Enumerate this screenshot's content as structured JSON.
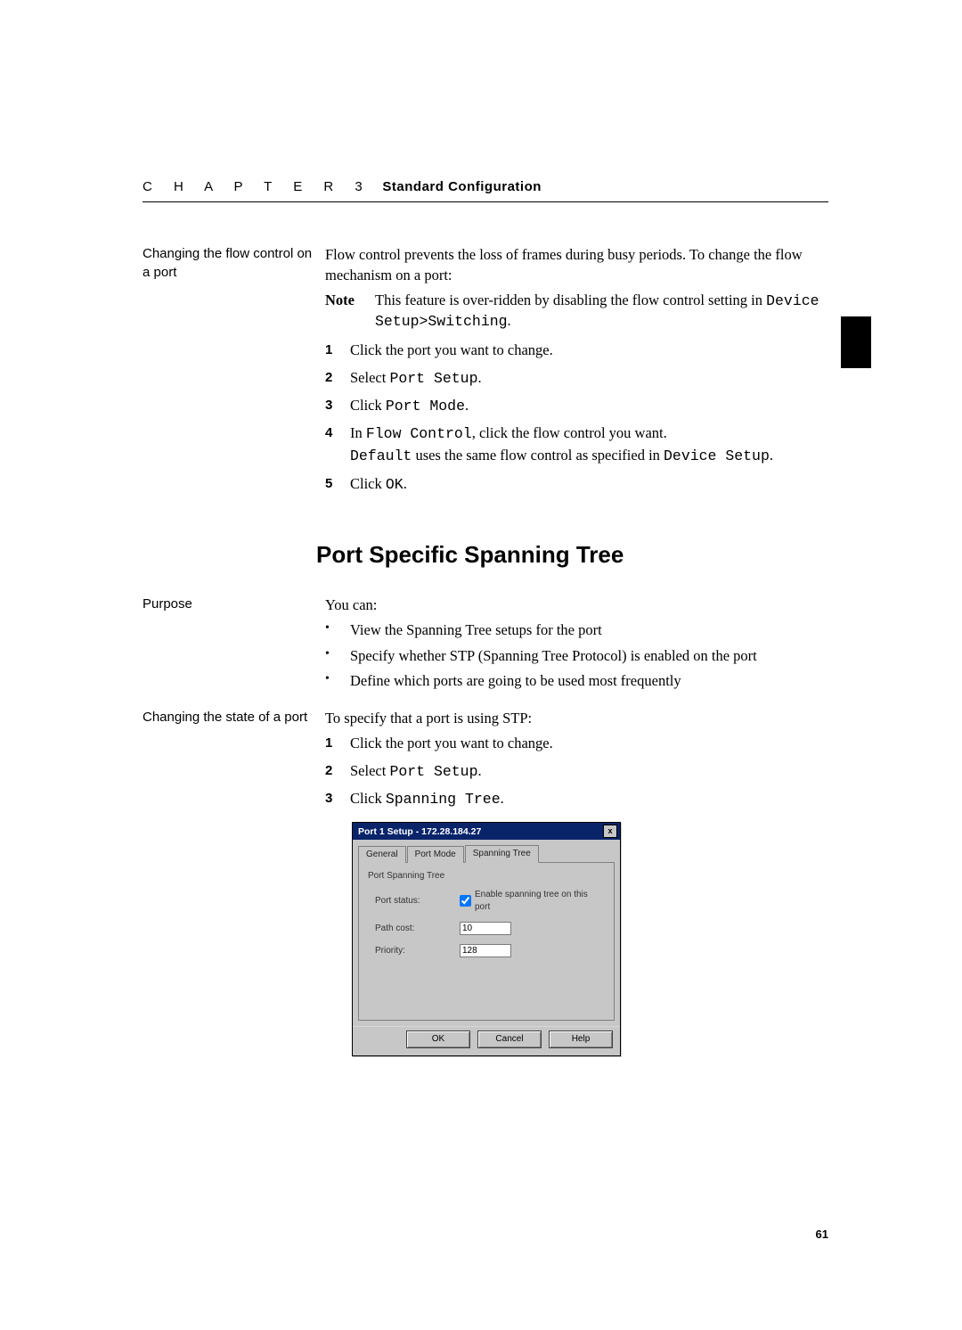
{
  "header": {
    "chapter_word": "C H A P T E R 3",
    "chapter_title": "Standard Configuration"
  },
  "tab_marker": "",
  "section1": {
    "side_label": "Changing the flow control on a port",
    "intro": "Flow control prevents the loss of frames during busy periods. To change the flow mechanism on a port:",
    "note_label": "Note",
    "note_text_a": "This feature is over-ridden by disabling the flow control setting in ",
    "note_code": "Device Setup>Switching",
    "note_period": ".",
    "steps": [
      {
        "n": "1",
        "a": "Click the port you want to change."
      },
      {
        "n": "2",
        "a": "Select ",
        "code": "Port Setup",
        "p": "."
      },
      {
        "n": "3",
        "a": "Click ",
        "code": "Port Mode",
        "p": "."
      },
      {
        "n": "4",
        "a": "In ",
        "code": "Flow Control",
        "p": ", click the flow control you want.",
        "sub_code_a": "Default",
        "sub_mid": " uses the same flow control as specified in ",
        "sub_code_b": "Device Setup",
        "sub_end": "."
      },
      {
        "n": "5",
        "a": "Click ",
        "code": "OK",
        "p": "."
      }
    ]
  },
  "heading": "Port Specific Spanning Tree",
  "section2": {
    "side_label": "Purpose",
    "intro": "You can:",
    "bullets": [
      "View the Spanning Tree setups for the port",
      "Specify whether STP (Spanning Tree Protocol) is enabled on the port",
      "Define which ports are going to be used most frequently"
    ]
  },
  "section3": {
    "side_label": "Changing the state of a port",
    "intro": "To specify that a port is using STP:",
    "steps": [
      {
        "n": "1",
        "a": "Click the port you want to change."
      },
      {
        "n": "2",
        "a": "Select ",
        "code": "Port Setup",
        "p": "."
      },
      {
        "n": "3",
        "a": "Click ",
        "code": "Spanning Tree",
        "p": "."
      }
    ]
  },
  "dialog": {
    "title": "Port 1 Setup - 172.28.184.27",
    "close_x": "x",
    "tabs": {
      "general": "General",
      "portmode": "Port Mode",
      "spanning": "Spanning Tree"
    },
    "group": "Port Spanning Tree",
    "labels": {
      "status": "Port status:",
      "pathcost": "Path cost:",
      "priority": "Priority:"
    },
    "checkbox_label": "Enable spanning tree on this port",
    "values": {
      "pathcost": "10",
      "priority": "128"
    },
    "buttons": {
      "ok": "OK",
      "cancel": "Cancel",
      "help": "Help"
    }
  },
  "page_number": "61"
}
